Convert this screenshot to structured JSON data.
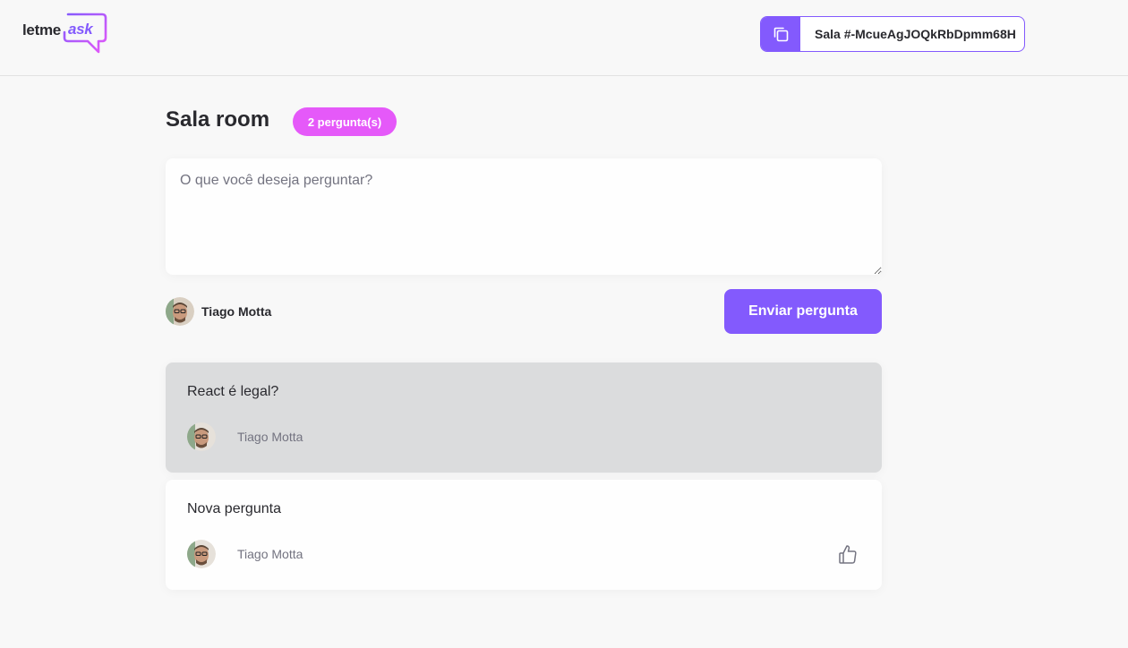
{
  "header": {
    "logo": {
      "part1": "letme",
      "part2": "ask"
    },
    "room_code": {
      "label": "Sala #-McueAgJOQkRbDpmm68H",
      "icon": "copy-icon"
    }
  },
  "room": {
    "title": "Sala room",
    "question_count": "2 pergunta(s)",
    "form": {
      "placeholder": "O que você deseja perguntar?",
      "value": "",
      "user_name": "Tiago Motta",
      "submit_label": "Enviar pergunta"
    }
  },
  "questions": [
    {
      "content": "React é legal?",
      "author": "Tiago Motta",
      "highlighted": true,
      "like_icon": null
    },
    {
      "content": "Nova pergunta",
      "author": "Tiago Motta",
      "highlighted": false,
      "like_icon": "thumbs-up-icon"
    }
  ],
  "colors": {
    "brand": "#835afd",
    "badge": "#e559f9",
    "background": "#f8f8f8",
    "highlighted_card": "#dbdcdd",
    "text": "#29292e",
    "muted_text": "#737380"
  }
}
